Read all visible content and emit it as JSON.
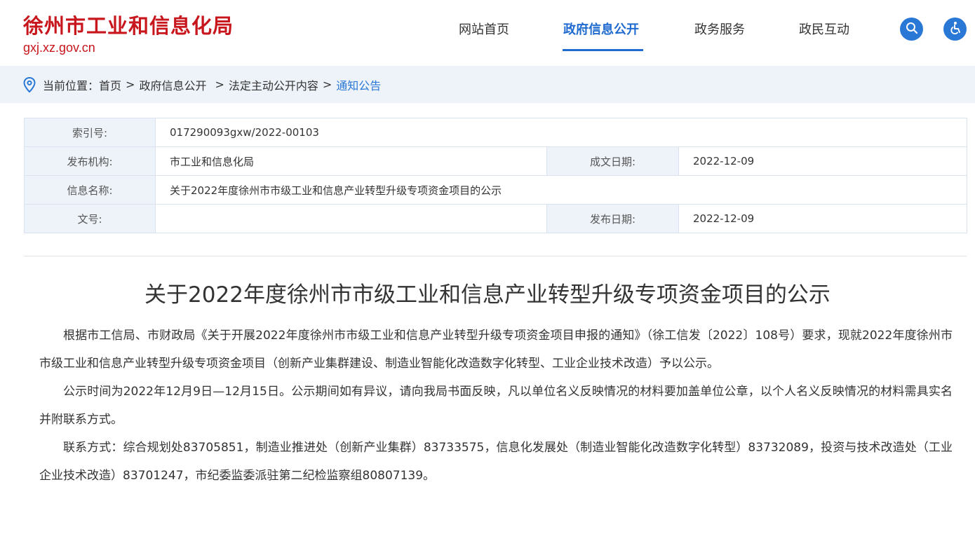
{
  "site": {
    "title": "徐州市工业和信息化局",
    "domain": "gxj.xz.gov.cn"
  },
  "nav": {
    "items": [
      {
        "label": "网站首页"
      },
      {
        "label": "政府信息公开"
      },
      {
        "label": "政务服务"
      },
      {
        "label": "政民互动"
      }
    ],
    "active": "政府信息公开",
    "search_icon": "search-icon",
    "accessibility_icon": "accessibility-icon"
  },
  "breadcrumb": {
    "prefix": "当前位置：",
    "items": [
      "首页",
      "政府信息公开",
      "法定主动公开内容",
      "通知公告"
    ]
  },
  "meta": {
    "index_label": "索引号:",
    "index_value": "017290093gxw/2022-00103",
    "publisher_label": "发布机构:",
    "publisher_value": "市工业和信息化局",
    "created_label": "成文日期:",
    "created_value": "2022-12-09",
    "name_label": "信息名称:",
    "name_value": "关于2022年度徐州市市级工业和信息产业转型升级专项资金项目的公示",
    "doc_no_label": "文号:",
    "doc_no_value": "",
    "published_label": "发布日期:",
    "published_value": "2022-12-09"
  },
  "article": {
    "title": "关于2022年度徐州市市级工业和信息产业转型升级专项资金项目的公示",
    "paragraphs": [
      "根据市工信局、市财政局《关于开展2022年度徐州市市级工业和信息产业转型升级专项资金项目申报的通知》（徐工信发〔2022〕108号）要求，现就2022年度徐州市市级工业和信息产业转型升级专项资金项目（创新产业集群建设、制造业智能化改造数字化转型、工业企业技术改造）予以公示。",
      "公示时间为2022年12月9日—12月15日。公示期间如有异议，请向我局书面反映，凡以单位名义反映情况的材料要加盖单位公章，以个人名义反映情况的材料需具实名并附联系方式。",
      "联系方式：综合规划处83705851，制造业推进处（创新产业集群）83733575，信息化发展处（制造业智能化改造数字化转型）83732089，投资与技术改造处（工业企业技术改造）83701247，市纪委监委派驻第二纪检监察组80807139。"
    ]
  },
  "colors": {
    "brand_red": "#c8161d",
    "accent_blue": "#1f6bd0",
    "label_bg": "#eef3fa"
  }
}
